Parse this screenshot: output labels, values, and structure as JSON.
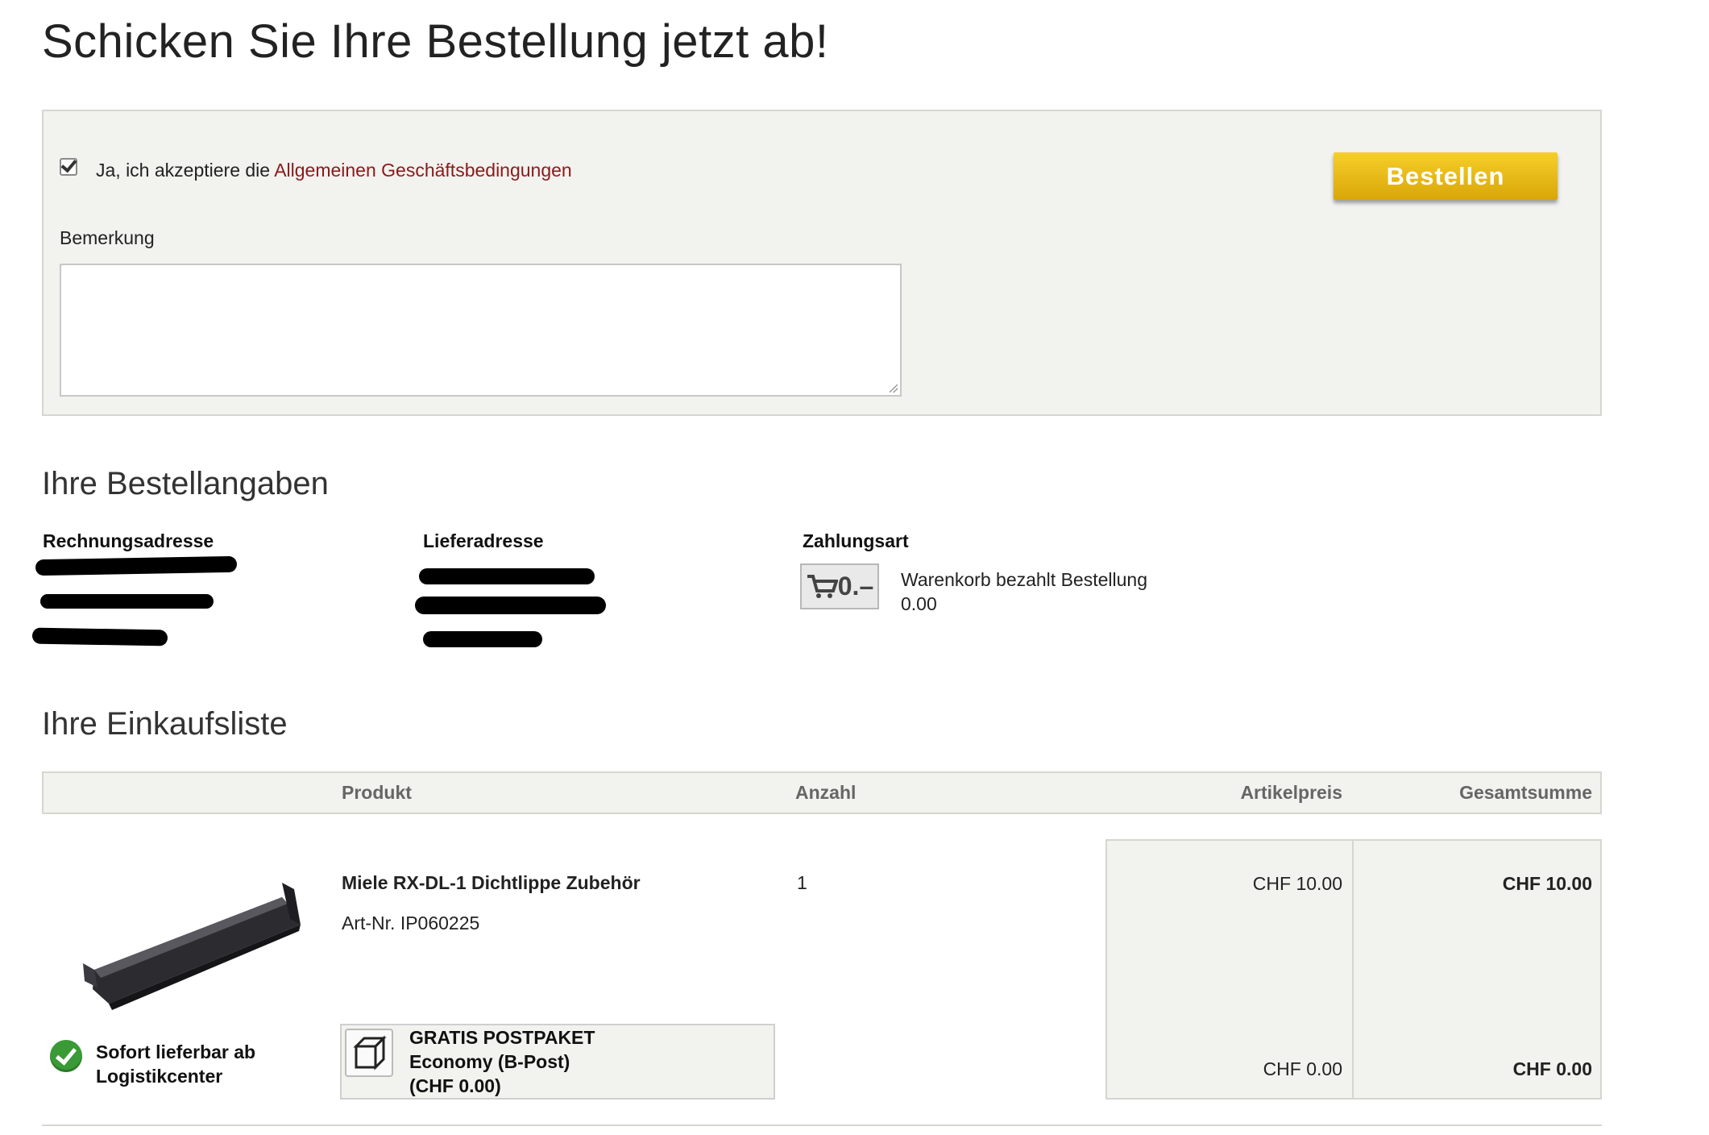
{
  "page_title": "Schicken Sie Ihre Bestellung jetzt ab!",
  "order_form": {
    "agb_prefix": "Ja, ich akzeptiere die ",
    "agb_link": "Allgemeinen Geschäftsbedingungen",
    "agb_checked": true,
    "remark_label": "Bemerkung",
    "remark_value": "",
    "order_button": "Bestellen"
  },
  "details": {
    "heading": "Ihre Bestellangaben",
    "billing_label": "Rechnungsadresse",
    "shipping_label": "Lieferadresse",
    "payment_label": "Zahlungsart",
    "payment_icon_text": "0.–",
    "payment_method": "Warenkorb bezahlt Bestellung",
    "payment_amount": "0.00"
  },
  "cart": {
    "heading": "Ihre Einkaufsliste",
    "columns": {
      "product": "Produkt",
      "quantity": "Anzahl",
      "unit_price": "Artikelpreis",
      "total": "Gesamtsumme"
    },
    "item": {
      "name": "Miele RX-DL-1 Dichtlippe Zubehör",
      "article_no": "Art-Nr. IP060225",
      "quantity": "1",
      "unit_price": "CHF 10.00",
      "total": "CHF 10.00",
      "availability_line1": "Sofort lieferbar ab",
      "availability_line2": "Logistikcenter"
    },
    "shipping": {
      "line1": "GRATIS POSTPAKET",
      "line2": "Economy (B-Post)",
      "line3": "(CHF 0.00)",
      "unit_price": "CHF 0.00",
      "total": "CHF 0.00"
    }
  },
  "colors": {
    "link": "#8a1a1a",
    "button": "#e7b616",
    "panel_bg": "#f2f2ef",
    "available_green": "#3a9a36"
  }
}
